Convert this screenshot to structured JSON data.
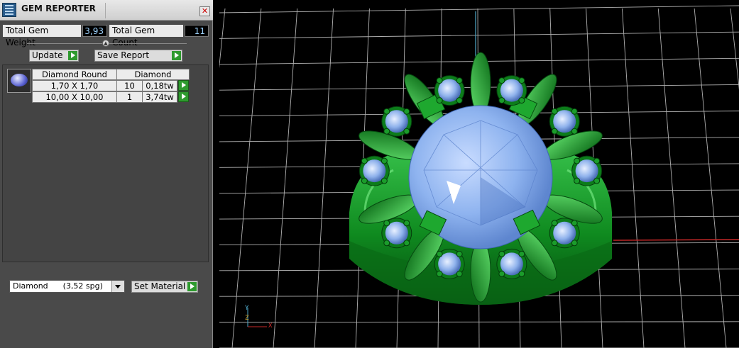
{
  "panel": {
    "title": "GEM REPORTER",
    "close_glyph": "✕",
    "total_weight_label": "Total Gem Weight",
    "total_weight_value": "3,93",
    "total_count_label": "Total Gem Count",
    "total_count_value": "11",
    "update_label": "Update",
    "save_report_label": "Save Report",
    "table": {
      "headers": [
        "Diamond Round",
        "Diamond"
      ],
      "rows": [
        {
          "size": "1,70 X 1,70",
          "count": "10",
          "weight": "0,18tw"
        },
        {
          "size": "10,00 X 10,00",
          "count": "1",
          "weight": "3,74tw"
        }
      ]
    },
    "material_value": "Diamond      (3,52 spg)",
    "set_material_label": "Set Material"
  },
  "viewport": {
    "axes": {
      "x": "X",
      "y": "Y",
      "z": "Z"
    },
    "colors": {
      "metal": "#0f8a1f",
      "stone": "#8eb3ef",
      "grid": "#cfcfcf",
      "x_axis": "#c62828",
      "y_axis": "#4fa8c8"
    }
  }
}
